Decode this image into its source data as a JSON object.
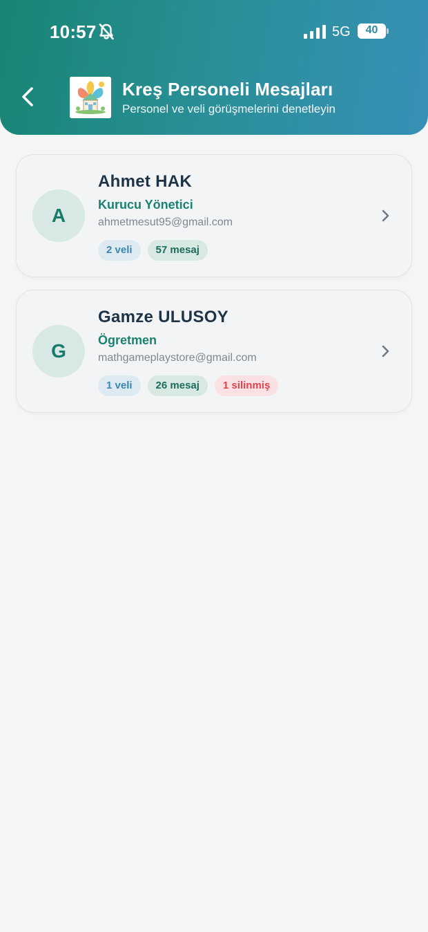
{
  "status_bar": {
    "time": "10:57",
    "network": "5G",
    "battery": "40",
    "battery_level_percent": 40
  },
  "header": {
    "title": "Kreş Personeli Mesajları",
    "subtitle": "Personel ve veli görüşmelerini denetleyin"
  },
  "colors": {
    "header_gradient_start": "#178573",
    "header_gradient_end": "#3890b7",
    "accent_green": "#198270",
    "deleted_red": "#e1424d"
  },
  "icons": {
    "back": "chevron-left-icon",
    "mute": "bell-off-icon",
    "row_action": "chevron-right-icon"
  },
  "staff": [
    {
      "initial": "A",
      "name": "Ahmet HAK",
      "role": "Kurucu Yönetici",
      "email": "ahmetmesut95@gmail.com",
      "veli": "2 veli",
      "mesaj": "57 mesaj"
    },
    {
      "initial": "G",
      "name": "Gamze ULUSOY",
      "role": "Ögretmen",
      "email": "mathgameplaystore@gmail.com",
      "veli": "1 veli",
      "mesaj": "26 mesaj",
      "silinmis": "1 silinmiş"
    }
  ]
}
